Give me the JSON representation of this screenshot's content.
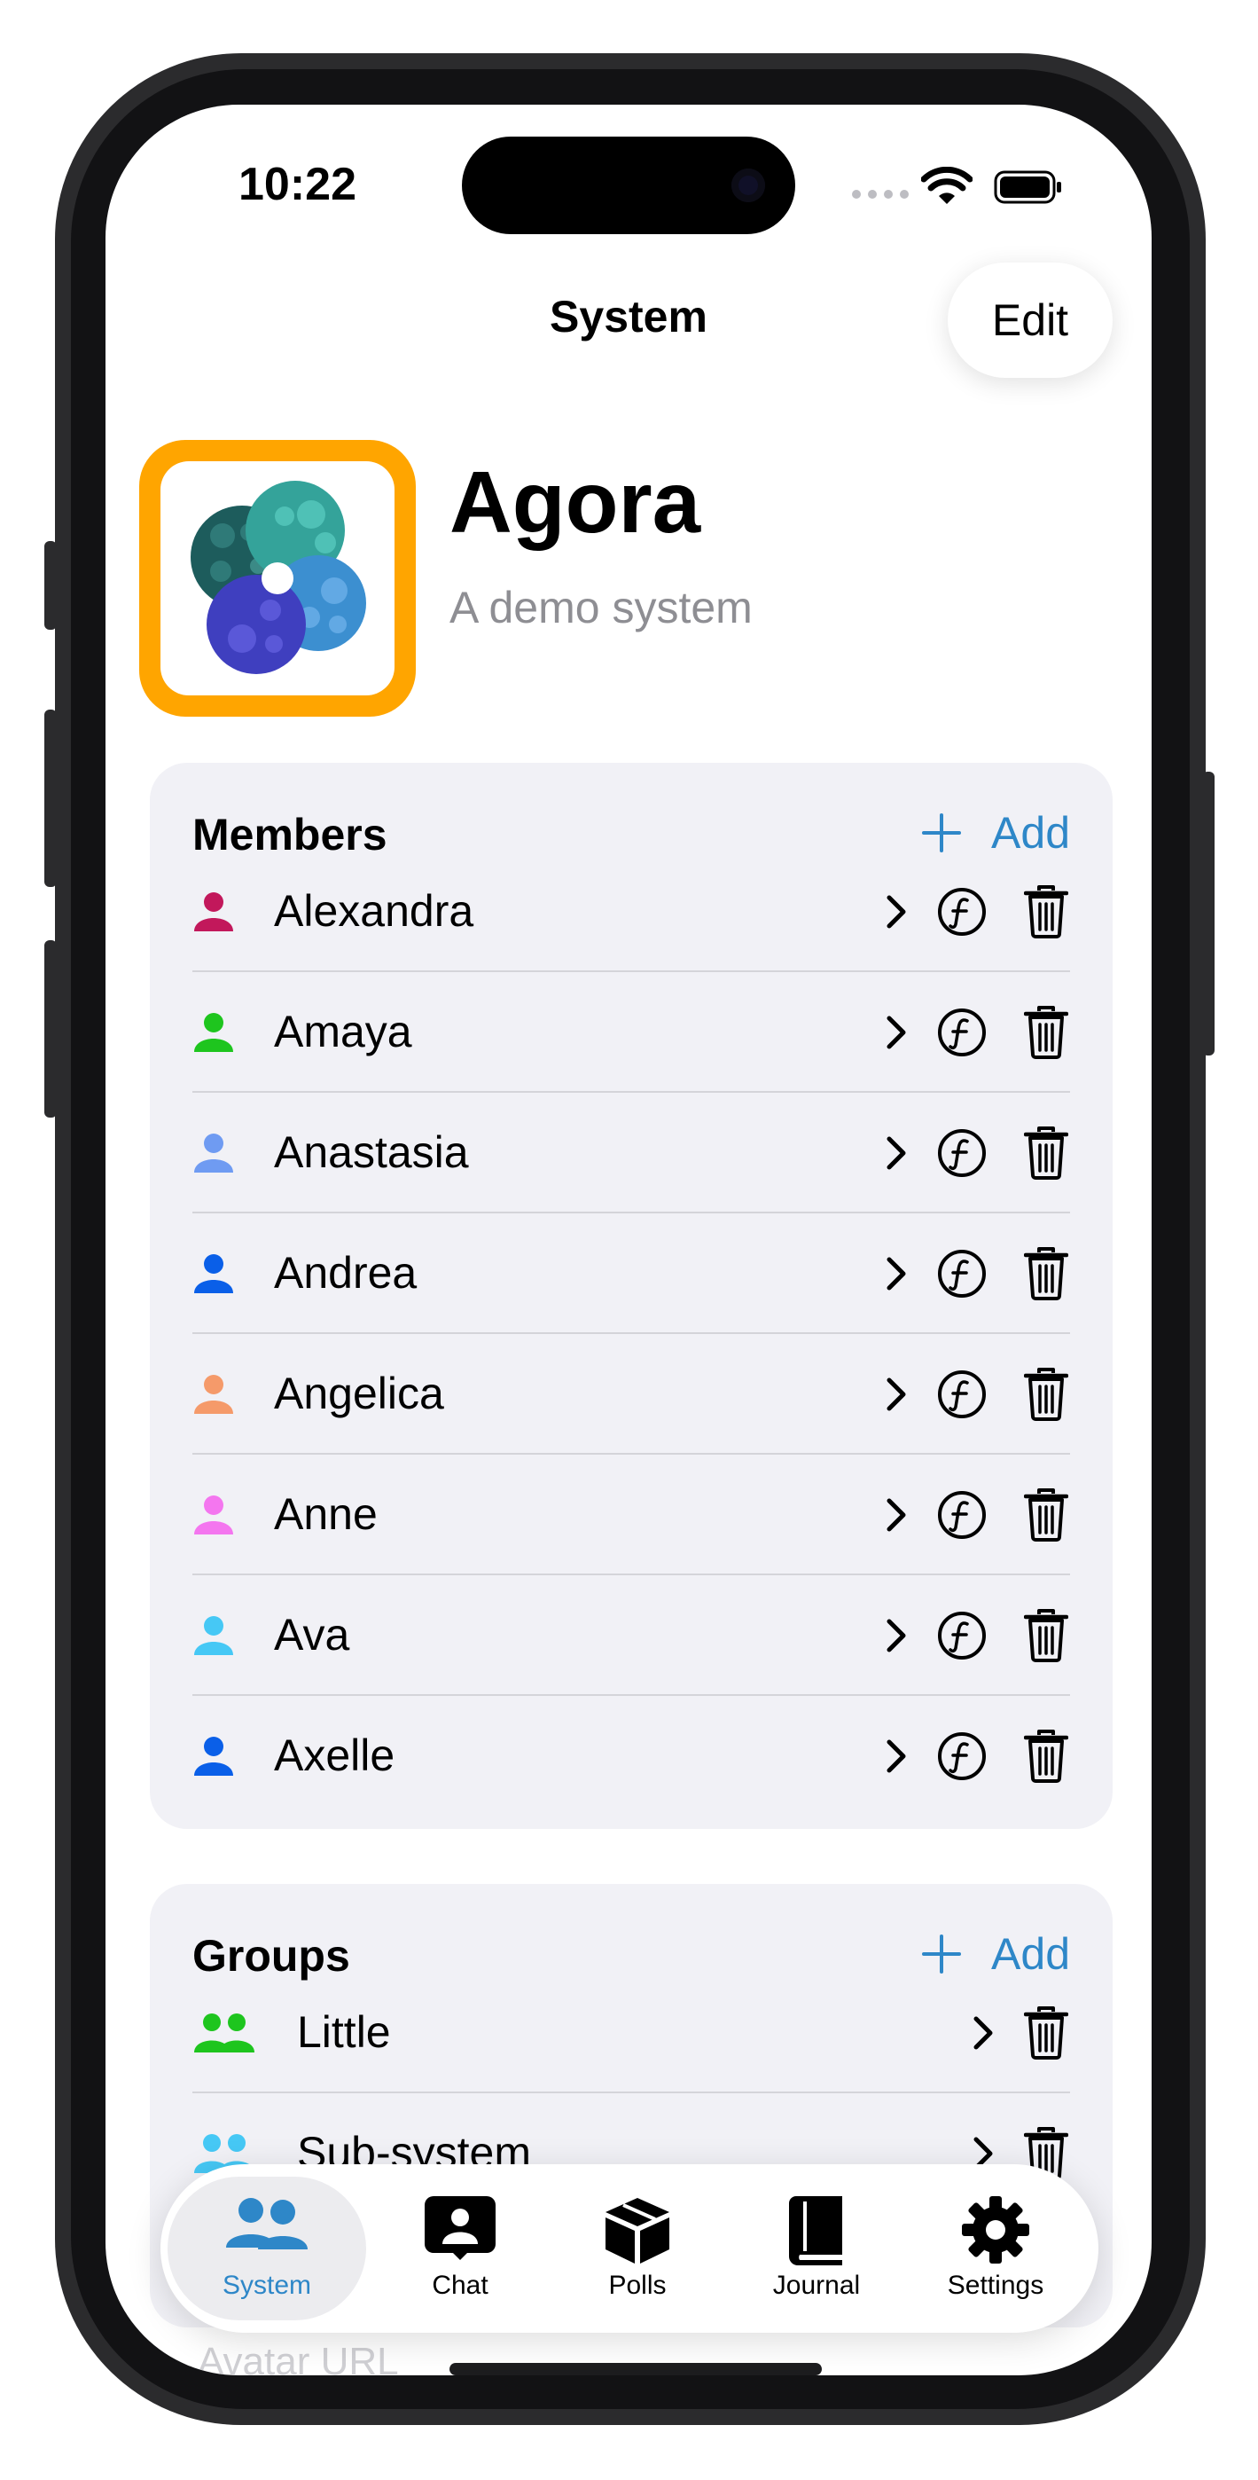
{
  "status_bar": {
    "time": "10:22"
  },
  "nav": {
    "title": "System",
    "edit_label": "Edit"
  },
  "system": {
    "name": "Agora",
    "description": "A demo system",
    "avatar_border_color": "#FFA500"
  },
  "members": {
    "header": "Members",
    "add_label": "Add",
    "items": [
      {
        "name": "Alexandra",
        "color": "#C2185B"
      },
      {
        "name": "Amaya",
        "color": "#1EC51E"
      },
      {
        "name": "Anastasia",
        "color": "#6F9BF2"
      },
      {
        "name": "Andrea",
        "color": "#0A5FE8"
      },
      {
        "name": "Angelica",
        "color": "#F59A6A"
      },
      {
        "name": "Anne",
        "color": "#F476EF"
      },
      {
        "name": "Ava",
        "color": "#46C8F5"
      },
      {
        "name": "Axelle",
        "color": "#0A5FE8"
      }
    ]
  },
  "groups": {
    "header": "Groups",
    "add_label": "Add",
    "items": [
      {
        "name": "Little",
        "color": "#1EC51E"
      },
      {
        "name": "Sub-system",
        "color": "#46C8F5"
      }
    ]
  },
  "peek_field": {
    "label": "Avatar URL"
  },
  "tabbar": {
    "tabs": [
      {
        "label": "System",
        "icon": "two-people-icon",
        "active": true
      },
      {
        "label": "Chat",
        "icon": "person-bubble-icon",
        "active": false
      },
      {
        "label": "Polls",
        "icon": "box-icon",
        "active": false
      },
      {
        "label": "Journal",
        "icon": "book-icon",
        "active": false
      },
      {
        "label": "Settings",
        "icon": "gear-icon",
        "active": false
      }
    ]
  },
  "colors": {
    "accent": "#2E87C8",
    "card_bg": "#F1F1F6"
  }
}
